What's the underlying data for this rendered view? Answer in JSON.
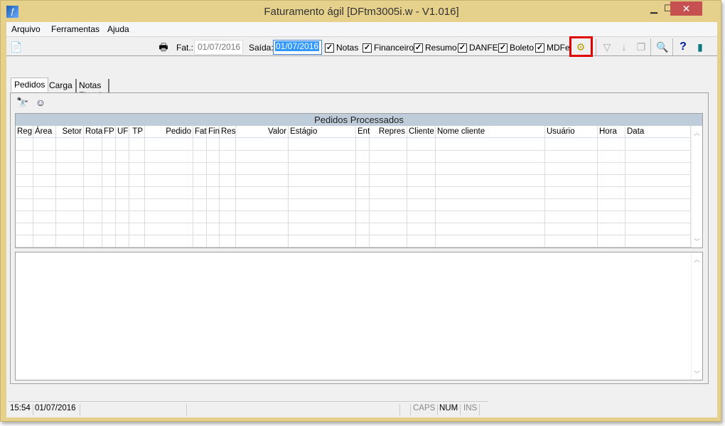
{
  "window": {
    "title": "Faturamento ágil [DFtm3005i.w - V1.016]",
    "minimize": "▁",
    "maximize": "☐",
    "close": "✕"
  },
  "menu": [
    "Arquivo",
    "Ferramentas",
    "Ajuda"
  ],
  "toolbar": {
    "fat_label": "Fat.:",
    "fat_value": "01/07/2016",
    "saida_label": "Saída:",
    "saida_value": "01/07/2016",
    "checks": [
      {
        "label": "Notas",
        "checked": true
      },
      {
        "label": "Financeiro",
        "checked": true
      },
      {
        "label": "Resumo",
        "checked": true
      },
      {
        "label": "DANFE",
        "checked": true
      },
      {
        "label": "Boleto",
        "checked": true
      },
      {
        "label": "MDFe",
        "checked": true
      }
    ],
    "highlight_color": "#e00000",
    "help": "?"
  },
  "tabs": [
    "Pedidos",
    "Carga",
    "Notas Fiscais"
  ],
  "grid": {
    "title": "Pedidos Processados",
    "columns": [
      "Reg",
      "Área",
      "Setor",
      "Rota",
      "FP",
      "UF",
      "TP",
      "Pedido",
      "Fat",
      "Fin",
      "Res",
      "Valor",
      "Estágio",
      "Ent",
      "Repres",
      "Cliente",
      "Nome cliente",
      "Usuário",
      "Hora",
      "Data"
    ],
    "rows": []
  },
  "status": {
    "time": "15:54",
    "date": "01/07/2016",
    "caps": "CAPS",
    "num": "NUM",
    "ins": "INS"
  }
}
